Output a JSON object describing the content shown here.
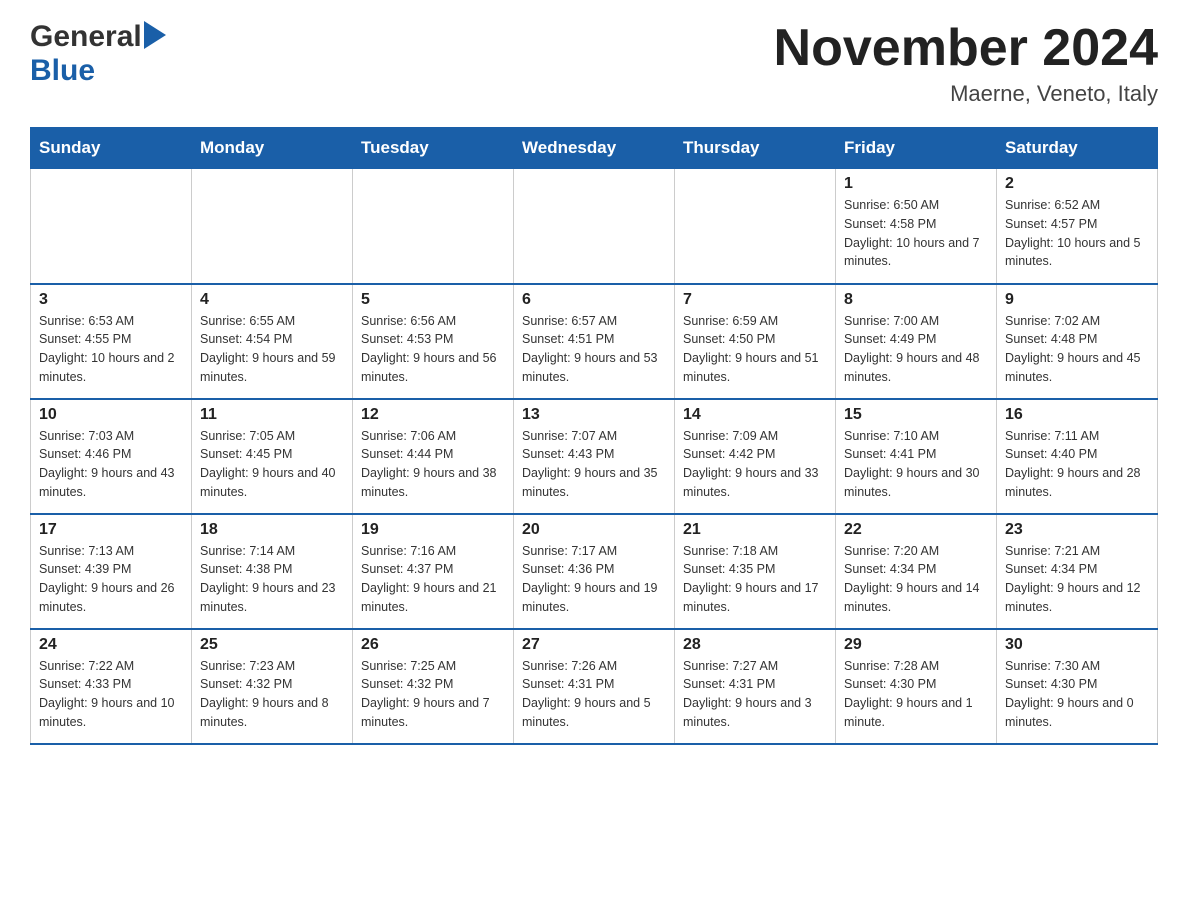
{
  "header": {
    "logo_general": "General",
    "logo_blue": "Blue",
    "month_title": "November 2024",
    "location": "Maerne, Veneto, Italy"
  },
  "weekdays": [
    "Sunday",
    "Monday",
    "Tuesday",
    "Wednesday",
    "Thursday",
    "Friday",
    "Saturday"
  ],
  "weeks": [
    [
      {
        "day": "",
        "sunrise": "",
        "sunset": "",
        "daylight": ""
      },
      {
        "day": "",
        "sunrise": "",
        "sunset": "",
        "daylight": ""
      },
      {
        "day": "",
        "sunrise": "",
        "sunset": "",
        "daylight": ""
      },
      {
        "day": "",
        "sunrise": "",
        "sunset": "",
        "daylight": ""
      },
      {
        "day": "",
        "sunrise": "",
        "sunset": "",
        "daylight": ""
      },
      {
        "day": "1",
        "sunrise": "Sunrise: 6:50 AM",
        "sunset": "Sunset: 4:58 PM",
        "daylight": "Daylight: 10 hours and 7 minutes."
      },
      {
        "day": "2",
        "sunrise": "Sunrise: 6:52 AM",
        "sunset": "Sunset: 4:57 PM",
        "daylight": "Daylight: 10 hours and 5 minutes."
      }
    ],
    [
      {
        "day": "3",
        "sunrise": "Sunrise: 6:53 AM",
        "sunset": "Sunset: 4:55 PM",
        "daylight": "Daylight: 10 hours and 2 minutes."
      },
      {
        "day": "4",
        "sunrise": "Sunrise: 6:55 AM",
        "sunset": "Sunset: 4:54 PM",
        "daylight": "Daylight: 9 hours and 59 minutes."
      },
      {
        "day": "5",
        "sunrise": "Sunrise: 6:56 AM",
        "sunset": "Sunset: 4:53 PM",
        "daylight": "Daylight: 9 hours and 56 minutes."
      },
      {
        "day": "6",
        "sunrise": "Sunrise: 6:57 AM",
        "sunset": "Sunset: 4:51 PM",
        "daylight": "Daylight: 9 hours and 53 minutes."
      },
      {
        "day": "7",
        "sunrise": "Sunrise: 6:59 AM",
        "sunset": "Sunset: 4:50 PM",
        "daylight": "Daylight: 9 hours and 51 minutes."
      },
      {
        "day": "8",
        "sunrise": "Sunrise: 7:00 AM",
        "sunset": "Sunset: 4:49 PM",
        "daylight": "Daylight: 9 hours and 48 minutes."
      },
      {
        "day": "9",
        "sunrise": "Sunrise: 7:02 AM",
        "sunset": "Sunset: 4:48 PM",
        "daylight": "Daylight: 9 hours and 45 minutes."
      }
    ],
    [
      {
        "day": "10",
        "sunrise": "Sunrise: 7:03 AM",
        "sunset": "Sunset: 4:46 PM",
        "daylight": "Daylight: 9 hours and 43 minutes."
      },
      {
        "day": "11",
        "sunrise": "Sunrise: 7:05 AM",
        "sunset": "Sunset: 4:45 PM",
        "daylight": "Daylight: 9 hours and 40 minutes."
      },
      {
        "day": "12",
        "sunrise": "Sunrise: 7:06 AM",
        "sunset": "Sunset: 4:44 PM",
        "daylight": "Daylight: 9 hours and 38 minutes."
      },
      {
        "day": "13",
        "sunrise": "Sunrise: 7:07 AM",
        "sunset": "Sunset: 4:43 PM",
        "daylight": "Daylight: 9 hours and 35 minutes."
      },
      {
        "day": "14",
        "sunrise": "Sunrise: 7:09 AM",
        "sunset": "Sunset: 4:42 PM",
        "daylight": "Daylight: 9 hours and 33 minutes."
      },
      {
        "day": "15",
        "sunrise": "Sunrise: 7:10 AM",
        "sunset": "Sunset: 4:41 PM",
        "daylight": "Daylight: 9 hours and 30 minutes."
      },
      {
        "day": "16",
        "sunrise": "Sunrise: 7:11 AM",
        "sunset": "Sunset: 4:40 PM",
        "daylight": "Daylight: 9 hours and 28 minutes."
      }
    ],
    [
      {
        "day": "17",
        "sunrise": "Sunrise: 7:13 AM",
        "sunset": "Sunset: 4:39 PM",
        "daylight": "Daylight: 9 hours and 26 minutes."
      },
      {
        "day": "18",
        "sunrise": "Sunrise: 7:14 AM",
        "sunset": "Sunset: 4:38 PM",
        "daylight": "Daylight: 9 hours and 23 minutes."
      },
      {
        "day": "19",
        "sunrise": "Sunrise: 7:16 AM",
        "sunset": "Sunset: 4:37 PM",
        "daylight": "Daylight: 9 hours and 21 minutes."
      },
      {
        "day": "20",
        "sunrise": "Sunrise: 7:17 AM",
        "sunset": "Sunset: 4:36 PM",
        "daylight": "Daylight: 9 hours and 19 minutes."
      },
      {
        "day": "21",
        "sunrise": "Sunrise: 7:18 AM",
        "sunset": "Sunset: 4:35 PM",
        "daylight": "Daylight: 9 hours and 17 minutes."
      },
      {
        "day": "22",
        "sunrise": "Sunrise: 7:20 AM",
        "sunset": "Sunset: 4:34 PM",
        "daylight": "Daylight: 9 hours and 14 minutes."
      },
      {
        "day": "23",
        "sunrise": "Sunrise: 7:21 AM",
        "sunset": "Sunset: 4:34 PM",
        "daylight": "Daylight: 9 hours and 12 minutes."
      }
    ],
    [
      {
        "day": "24",
        "sunrise": "Sunrise: 7:22 AM",
        "sunset": "Sunset: 4:33 PM",
        "daylight": "Daylight: 9 hours and 10 minutes."
      },
      {
        "day": "25",
        "sunrise": "Sunrise: 7:23 AM",
        "sunset": "Sunset: 4:32 PM",
        "daylight": "Daylight: 9 hours and 8 minutes."
      },
      {
        "day": "26",
        "sunrise": "Sunrise: 7:25 AM",
        "sunset": "Sunset: 4:32 PM",
        "daylight": "Daylight: 9 hours and 7 minutes."
      },
      {
        "day": "27",
        "sunrise": "Sunrise: 7:26 AM",
        "sunset": "Sunset: 4:31 PM",
        "daylight": "Daylight: 9 hours and 5 minutes."
      },
      {
        "day": "28",
        "sunrise": "Sunrise: 7:27 AM",
        "sunset": "Sunset: 4:31 PM",
        "daylight": "Daylight: 9 hours and 3 minutes."
      },
      {
        "day": "29",
        "sunrise": "Sunrise: 7:28 AM",
        "sunset": "Sunset: 4:30 PM",
        "daylight": "Daylight: 9 hours and 1 minute."
      },
      {
        "day": "30",
        "sunrise": "Sunrise: 7:30 AM",
        "sunset": "Sunset: 4:30 PM",
        "daylight": "Daylight: 9 hours and 0 minutes."
      }
    ]
  ]
}
